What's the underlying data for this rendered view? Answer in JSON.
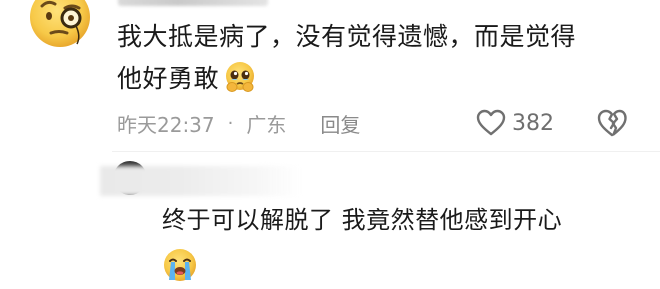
{
  "comment": {
    "avatar_icon": "face-with-monocle-emoji-icon",
    "text_line1": "我大抵是病了，没有觉得遗憾，而是觉得",
    "text_line2": "他好勇敢",
    "inline_emoji": "pleading-face-holding-back-tears-emoji-icon",
    "time": "昨天22:37",
    "separator": "·",
    "location": "广东",
    "reply_label": "回复",
    "like_icon": "heart-outline-icon",
    "like_count": "382",
    "dislike_icon": "broken-heart-icon"
  },
  "reply": {
    "avatar_icon": "avatar",
    "text": "终于可以解脱了 我竟然替他感到开心",
    "emoji": "loudly-crying-face-emoji-icon"
  },
  "colors": {
    "text": "#1a1a1a",
    "meta": "#9a9a9a",
    "emoji_yellow": "#f7c948",
    "tear_blue": "#5bb3f0"
  }
}
